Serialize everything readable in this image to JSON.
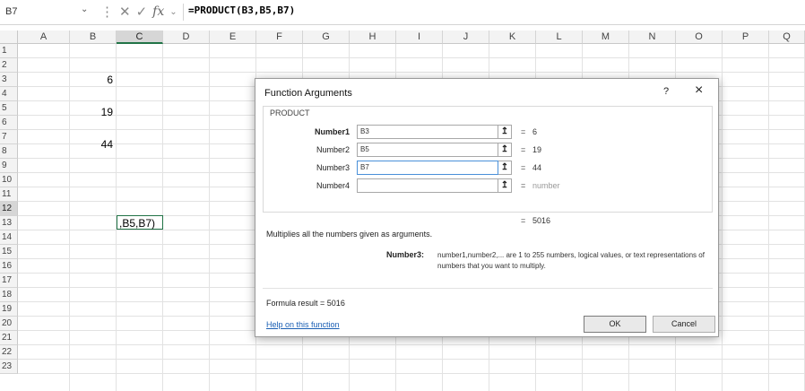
{
  "formula_bar": {
    "name_box": "B7",
    "fx": "fx",
    "formula": "=PRODUCT(B3,B5,B7)"
  },
  "columns": [
    "A",
    "B",
    "C",
    "D",
    "E",
    "F",
    "G",
    "H",
    "I",
    "J",
    "K",
    "L",
    "M",
    "N",
    "O",
    "P",
    "Q"
  ],
  "selected_column": "C",
  "rows": [
    "1",
    "2",
    "3",
    "4",
    "5",
    "6",
    "7",
    "8",
    "9",
    "10",
    "11",
    "12",
    "13",
    "14",
    "15",
    "16",
    "17",
    "18",
    "19",
    "20",
    "21",
    "22",
    "23"
  ],
  "selected_row": "12",
  "cells": {
    "B3": "6",
    "B5": "19",
    "B7": "44",
    "C12": ",B5,B7)"
  },
  "dialog": {
    "title": "Function Arguments",
    "help_icon": "?",
    "close_icon": "×",
    "function_name": "PRODUCT",
    "args": [
      {
        "label": "Number1",
        "value": "B3",
        "result": "6",
        "bold": true
      },
      {
        "label": "Number2",
        "value": "B5",
        "result": "19",
        "bold": false
      },
      {
        "label": "Number3",
        "value": "B7",
        "result": "44",
        "bold": false
      },
      {
        "label": "Number4",
        "value": "",
        "result": "number",
        "bold": false
      }
    ],
    "eq": "=",
    "total_result": "5016",
    "description": "Multiplies all the numbers given as arguments.",
    "arg_desc_label": "Number3:",
    "arg_desc_text": "number1,number2,... are 1 to 255 numbers, logical values, or text representations of numbers that you want to multiply.",
    "formula_result_label": "Formula result =",
    "formula_result_value": "5016",
    "help_link": "Help on this function",
    "ok_label": "OK",
    "cancel_label": "Cancel"
  }
}
